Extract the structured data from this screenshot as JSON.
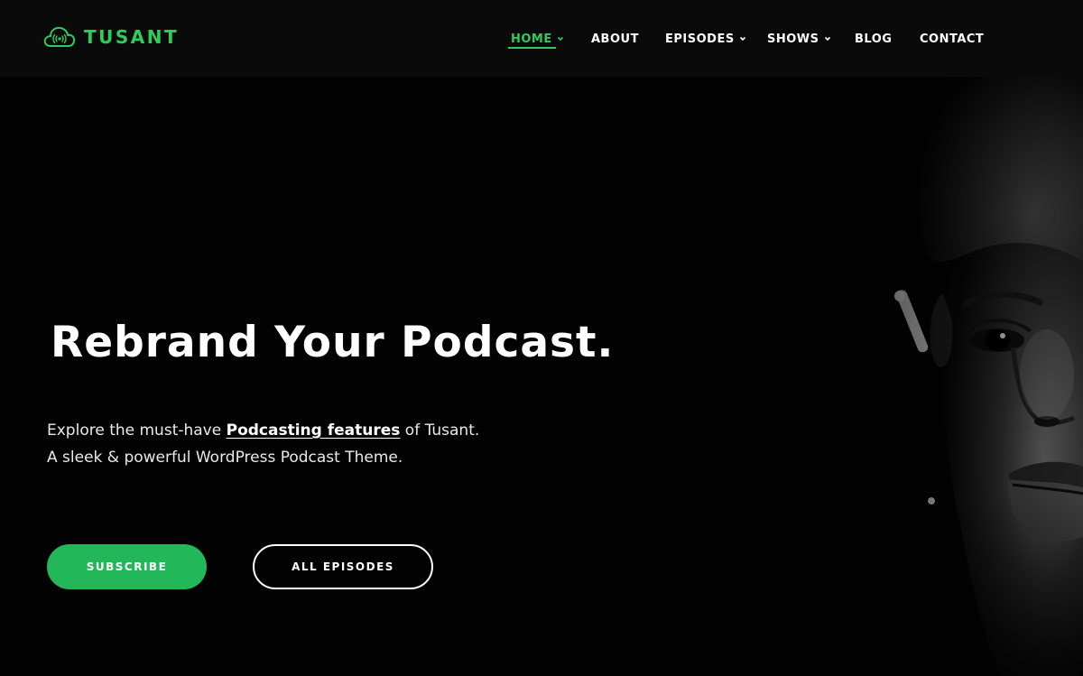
{
  "brand": {
    "name": "TUSANT",
    "logo_icon": "cloud-podcast-icon",
    "accent_color": "#2ecc5a"
  },
  "nav": {
    "items": [
      {
        "label": "HOME",
        "has_dropdown": true,
        "active": true
      },
      {
        "label": "ABOUT",
        "has_dropdown": false
      },
      {
        "label": "EPISODES",
        "has_dropdown": true
      },
      {
        "label": "SHOWS",
        "has_dropdown": true
      },
      {
        "label": "BLOG",
        "has_dropdown": false
      },
      {
        "label": "CONTACT",
        "has_dropdown": false
      }
    ]
  },
  "hero": {
    "title": "Rebrand Your Podcast.",
    "line1_before": "Explore the must-have ",
    "line1_link": "Podcasting features",
    "line1_after": " of Tusant.",
    "line2": "A sleek & powerful WordPress Podcast Theme.",
    "buttons": {
      "subscribe": "SUBSCRIBE",
      "all_episodes": "ALL EPISODES"
    },
    "subscribe_color": "#22b85a"
  }
}
